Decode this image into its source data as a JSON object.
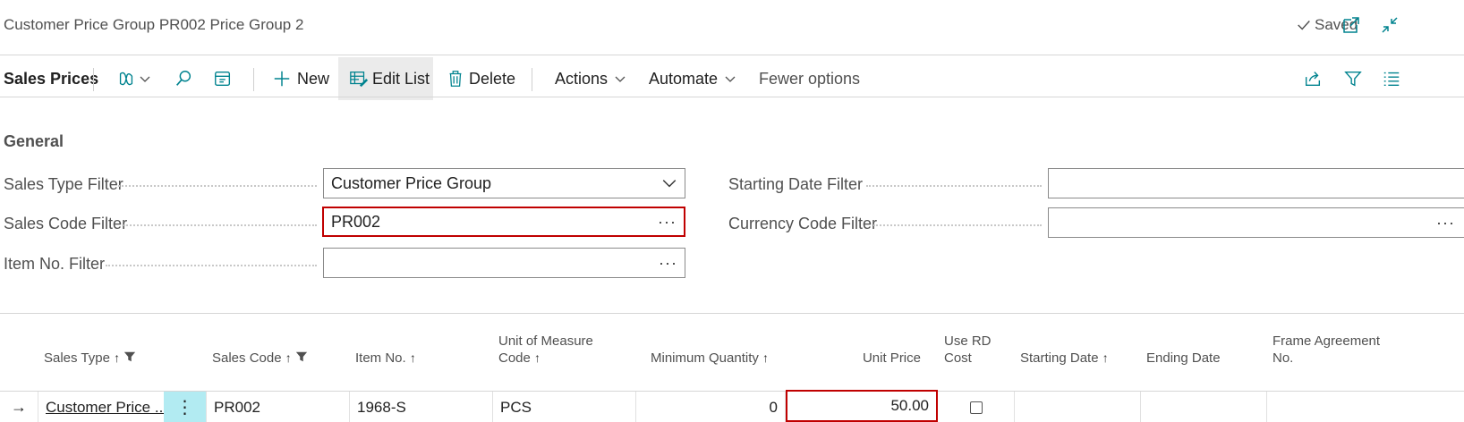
{
  "page": {
    "title": "Customer Price Group PR002 Price Group 2",
    "saved_label": "Saved"
  },
  "actionbar": {
    "title": "Sales Prices",
    "new_label": "New",
    "edit_list_label": "Edit List",
    "delete_label": "Delete",
    "actions_label": "Actions",
    "automate_label": "Automate",
    "fewer_options_label": "Fewer options"
  },
  "general": {
    "section_title": "General",
    "sales_type_filter": {
      "label": "Sales Type Filter",
      "value": "Customer Price Group"
    },
    "sales_code_filter": {
      "label": "Sales Code Filter",
      "value": "PR002"
    },
    "item_no_filter": {
      "label": "Item No. Filter",
      "value": ""
    },
    "starting_date_filter": {
      "label": "Starting Date Filter",
      "value": ""
    },
    "currency_code_filter": {
      "label": "Currency Code Filter",
      "value": ""
    },
    "ellipsis": "···"
  },
  "grid": {
    "columns": {
      "sales_type": "Sales Type",
      "sales_code": "Sales Code",
      "item_no": "Item No.",
      "uom_line1": "Unit of Measure",
      "uom_line2": "Code",
      "min_qty": "Minimum Quantity",
      "unit_price": "Unit Price",
      "use_rd_line1": "Use RD",
      "use_rd_line2": "Cost",
      "starting_date": "Starting Date",
      "ending_date": "Ending Date",
      "frame_line1": "Frame Agreement",
      "frame_line2": "No."
    },
    "sort_arrow": "↑",
    "rows": [
      {
        "row_indicator": "→",
        "sales_type": "Customer Price ...",
        "menu": "⋮",
        "sales_code": "PR002",
        "item_no": "1968-S",
        "uom": "PCS",
        "min_qty": "0",
        "unit_price": "50.00",
        "use_rd_cost": false,
        "starting_date": "",
        "ending_date": "",
        "frame_agreement": ""
      }
    ]
  },
  "colors": {
    "accent": "#00838f",
    "highlight_border": "#c00000",
    "row_menu_bg": "#b2ebf2"
  }
}
